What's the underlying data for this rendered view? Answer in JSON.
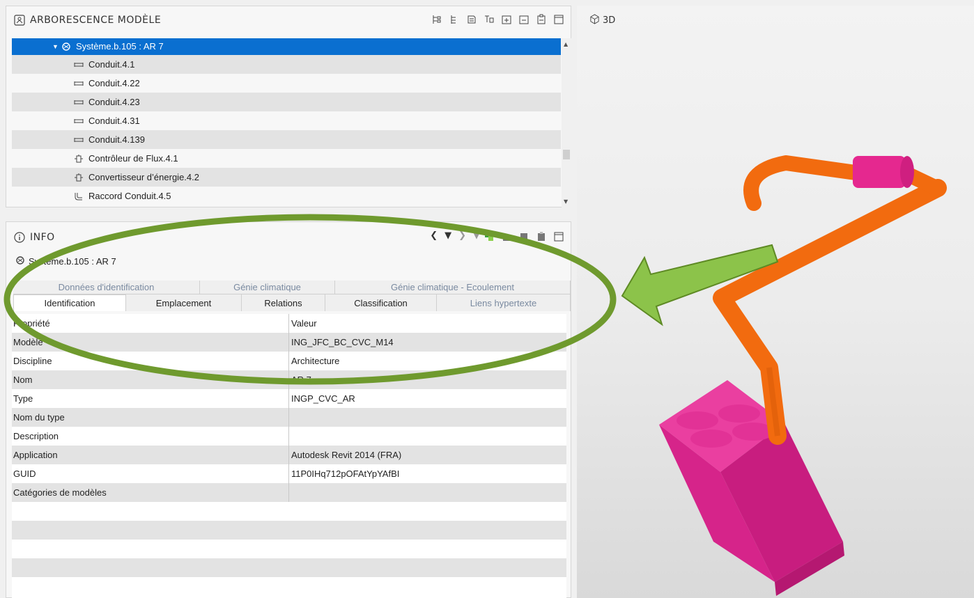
{
  "tree_panel": {
    "title": "ARBORESCENCE MODÈLE",
    "items": [
      {
        "label": "Système.b.105 : AR 7",
        "icon": "system-icon",
        "selected": true
      },
      {
        "label": "Conduit.4.1",
        "icon": "duct-icon"
      },
      {
        "label": "Conduit.4.22",
        "icon": "duct-icon"
      },
      {
        "label": "Conduit.4.23",
        "icon": "duct-icon"
      },
      {
        "label": "Conduit.4.31",
        "icon": "duct-icon"
      },
      {
        "label": "Conduit.4.139",
        "icon": "duct-icon"
      },
      {
        "label": "Contrôleur de Flux.4.1",
        "icon": "flow-controller-icon"
      },
      {
        "label": "Convertisseur d’énergie.4.2",
        "icon": "energy-converter-icon"
      },
      {
        "label": "Raccord Conduit.4.5",
        "icon": "duct-fitting-icon"
      }
    ]
  },
  "info_panel": {
    "title": "INFO",
    "subtitle": "Système.b.105 : AR 7",
    "tabs_row1": [
      "Données d'identification",
      "Génie climatique",
      "Génie climatique - Ecoulement"
    ],
    "tabs_row2": [
      "Identification",
      "Emplacement",
      "Relations",
      "Classification",
      "Liens hypertexte"
    ],
    "active_tab": "Identification",
    "table": {
      "headers": [
        "Propriété",
        "Valeur"
      ],
      "rows": [
        [
          "Modèle",
          "ING_JFC_BC_CVC_M14"
        ],
        [
          "Discipline",
          "Architecture"
        ],
        [
          "Nom",
          "AR 7"
        ],
        [
          "Type",
          "INGP_CVC_AR"
        ],
        [
          "Nom du type",
          ""
        ],
        [
          "Description",
          ""
        ],
        [
          "Application",
          "Autodesk Revit 2014 (FRA)"
        ],
        [
          "GUID",
          "11P0IHq712pOFAtYpYAfBI"
        ],
        [
          "Catégories de modèles",
          ""
        ]
      ]
    }
  },
  "view3d": {
    "title": "3D"
  },
  "colors": {
    "selection": "#0a6fd0",
    "duct": "#f26b0f",
    "unit": "#e5288f",
    "annotation": "#6f9a2e",
    "arrow_fill": "#8cc34a"
  }
}
